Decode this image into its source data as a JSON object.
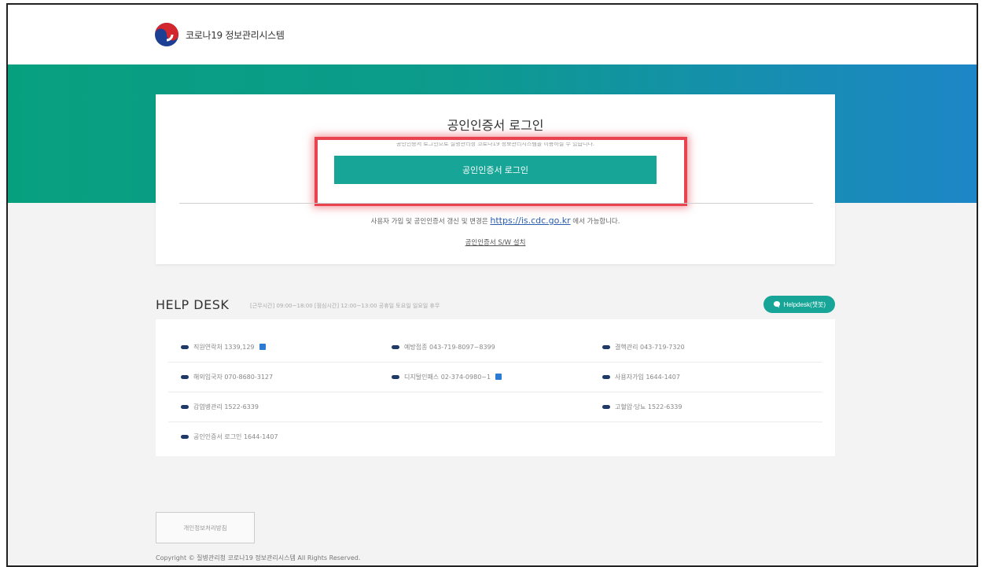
{
  "header": {
    "logo_text": "코로나19 정보관리시스템",
    "logo_icon": "taegeuk-emblem-icon"
  },
  "login": {
    "title": "공인인증서 로그인",
    "subtitle": "공인인증서 로그인으로 질병관리청 코로나19 정보관리시스템을 이용하실 수 있습니다.",
    "button_label": "공인인증서 로그인",
    "renew_prefix": "사용자 가입 및 공인인증서 갱신 및 변경은",
    "renew_link": "https://is.cdc.go.kr",
    "renew_suffix": "에서 가능합니다.",
    "sw_link": "공인인증서 S/W 설치"
  },
  "helpdesk": {
    "title": "HELP DESK",
    "hours": "[근무시간] 09:00~18:00 [점심시간] 12:00~13:00 공휴일 토요일 일요일 휴무",
    "chip_label": "Helpdesk(챗봇)",
    "rows": [
      [
        {
          "text": "직원연락처 1339,129",
          "ext": true
        },
        {
          "text": "예방접종 043-719-8097~8399",
          "ext": false
        },
        {
          "text": "결핵관리 043-719-7320",
          "ext": false
        }
      ],
      [
        {
          "text": "해외입국자 070-8680-3127",
          "ext": false
        },
        {
          "text": "디지털인패스 02-374-0980~1",
          "ext": true
        },
        {
          "text": "사용자가입 1644-1407",
          "ext": false
        }
      ],
      [
        {
          "text": "감염병관리 1522-6339",
          "ext": false
        },
        {
          "text": "",
          "ext": false
        },
        {
          "text": "고혈압·당뇨 1522-6339",
          "ext": false
        }
      ],
      [
        {
          "text": "공인인증서 로그인 1644-1407",
          "ext": false
        },
        {
          "text": "",
          "ext": false
        },
        {
          "text": "",
          "ext": false
        }
      ]
    ]
  },
  "footer": {
    "privacy_label": "개인정보처리방침",
    "copyright": "Copyright © 질병관리청 코로나19 정보관리시스템 All Rights Reserved."
  },
  "colors": {
    "accent": "#17a597",
    "banner_start": "#07a07f",
    "banner_end": "#1d86c7",
    "highlight": "#e8434f"
  }
}
